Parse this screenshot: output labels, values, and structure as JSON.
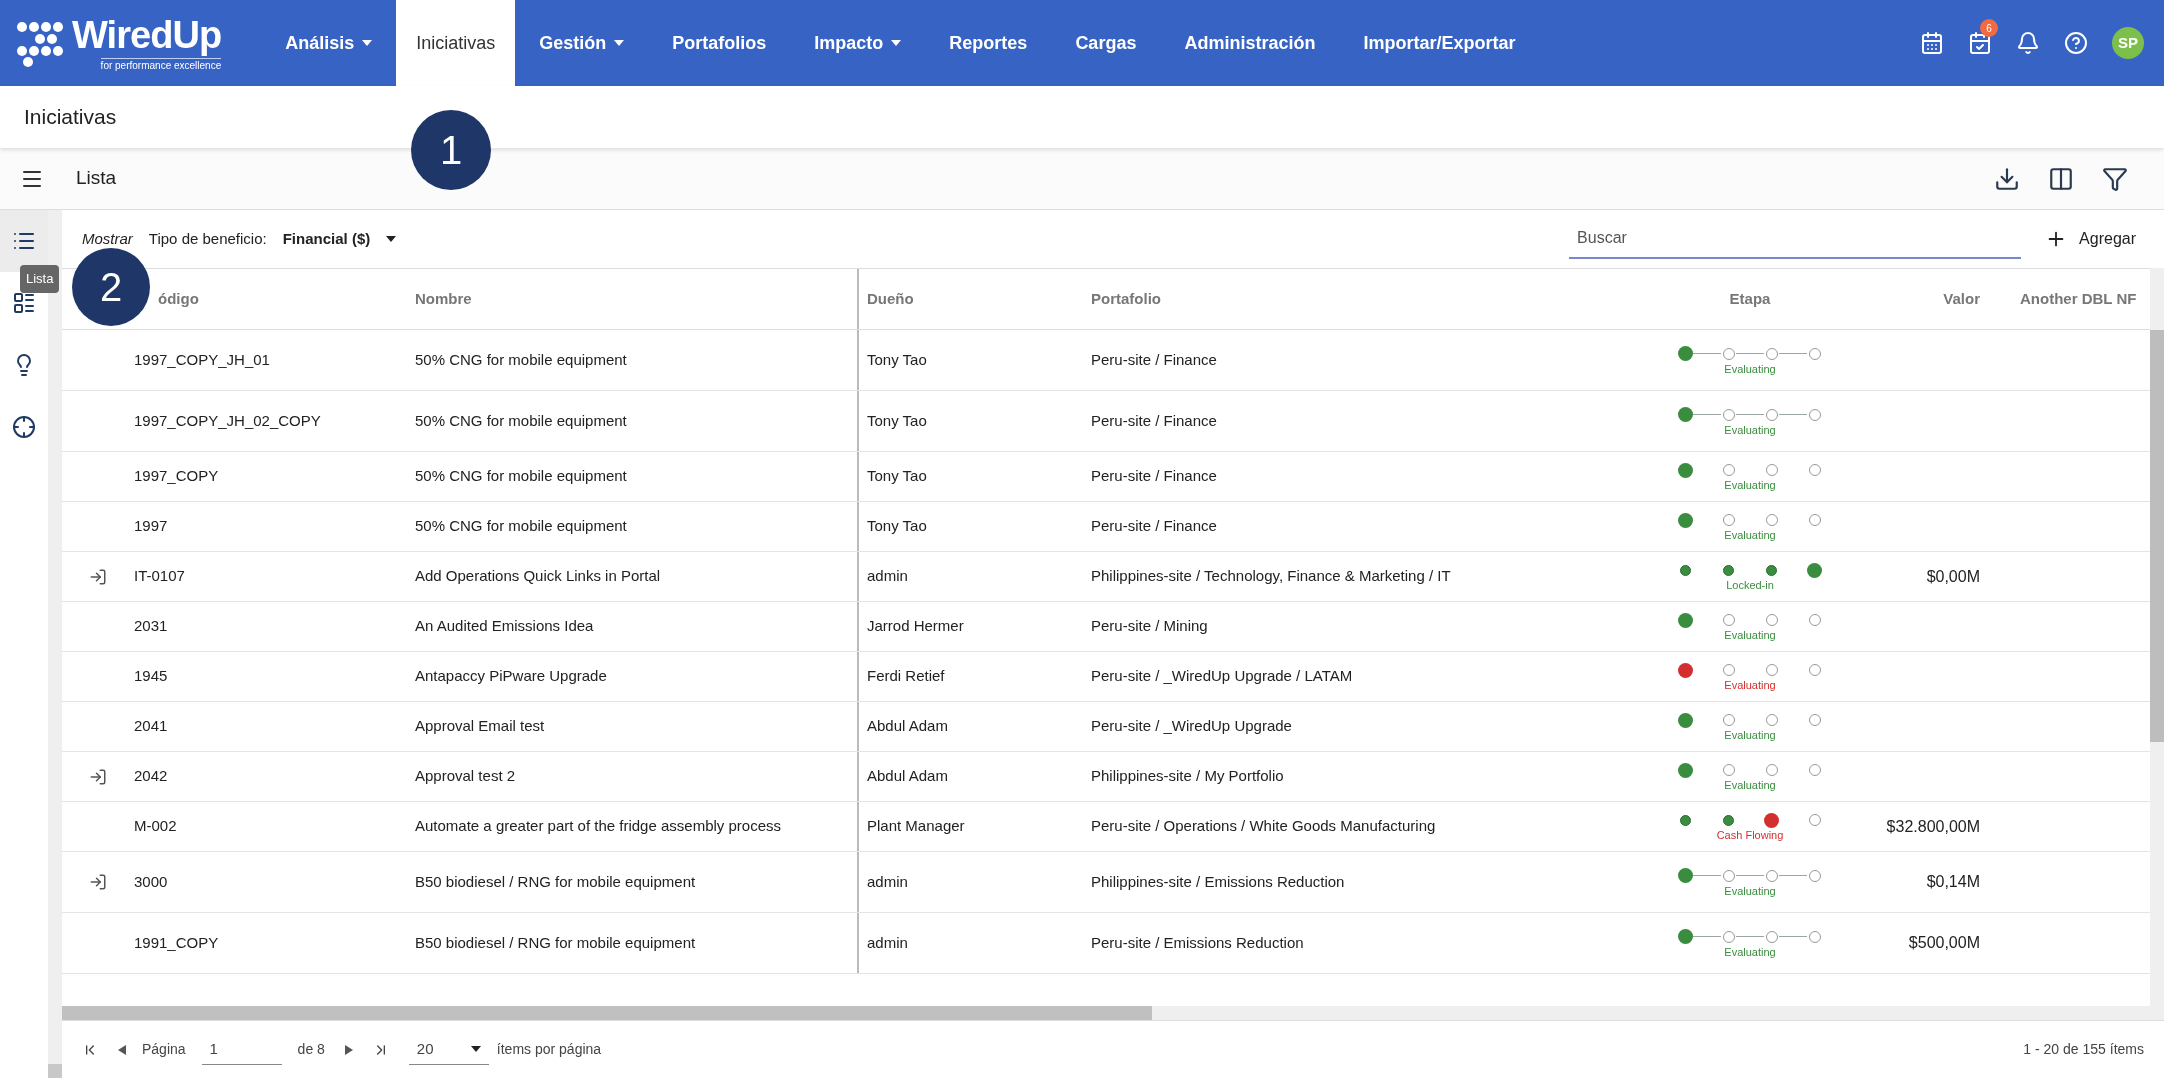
{
  "logo": {
    "name": "WiredUp",
    "tagline": "for performance excellence"
  },
  "nav": [
    {
      "label": "Análisis",
      "dropdown": true,
      "selected": false
    },
    {
      "label": "Iniciativas",
      "dropdown": false,
      "selected": true
    },
    {
      "label": "Gestión",
      "dropdown": true,
      "selected": false
    },
    {
      "label": "Portafolios",
      "dropdown": false,
      "selected": false
    },
    {
      "label": "Impacto",
      "dropdown": true,
      "selected": false
    },
    {
      "label": "Reportes",
      "dropdown": false,
      "selected": false
    },
    {
      "label": "Cargas",
      "dropdown": false,
      "selected": false
    },
    {
      "label": "Administración",
      "dropdown": false,
      "selected": false
    },
    {
      "label": "Importar/Exportar",
      "dropdown": false,
      "selected": false
    }
  ],
  "tasks_badge": "6",
  "avatar": "SP",
  "page_title": "Iniciativas",
  "view_title": "Lista",
  "rail": [
    {
      "kind": "list",
      "selected": true
    },
    {
      "kind": "details",
      "selected": false
    },
    {
      "kind": "idea",
      "selected": false
    },
    {
      "kind": "target",
      "selected": false
    }
  ],
  "tooltip": "Lista",
  "filter": {
    "show_label": "Mostrar",
    "benefit_label": "Tipo de beneficio:",
    "benefit_value": "Financial ($)"
  },
  "search": {
    "placeholder": "Buscar"
  },
  "add_button": "Agregar",
  "table": {
    "columns": [
      "",
      "ódigo",
      "Nombre",
      "Dueño",
      "Portafolio",
      "Etapa",
      "Valor",
      "Another DBL NF"
    ],
    "rows": [
      {
        "linked": false,
        "code": "1997_COPY_JH_01",
        "name": "50% CNG for mobile equipment",
        "owner": "Tony Tao",
        "portfolio": "Peru-site / Finance",
        "stage": {
          "steps": [
            {
              "filled": true,
              "current": true
            },
            {
              "filled": false,
              "current": false
            },
            {
              "filled": false,
              "current": false
            },
            {
              "filled": false,
              "current": false
            }
          ],
          "connected": true,
          "label": "Evaluating",
          "color": "#3a8c3f"
        },
        "value": ""
      },
      {
        "linked": false,
        "code": "1997_COPY_JH_02_COPY",
        "name": "50% CNG for mobile equipment",
        "owner": "Tony Tao",
        "portfolio": "Peru-site / Finance",
        "stage": {
          "steps": [
            {
              "filled": true,
              "current": true
            },
            {
              "filled": false,
              "current": false
            },
            {
              "filled": false,
              "current": false
            },
            {
              "filled": false,
              "current": false
            }
          ],
          "connected": true,
          "label": "Evaluating",
          "color": "#3a8c3f"
        },
        "value": ""
      },
      {
        "linked": false,
        "code": "1997_COPY",
        "name": "50% CNG for mobile equipment",
        "owner": "Tony Tao",
        "portfolio": "Peru-site / Finance",
        "stage": {
          "steps": [
            {
              "filled": true,
              "current": true
            },
            {
              "filled": false,
              "current": false
            },
            {
              "filled": false,
              "current": false
            },
            {
              "filled": false,
              "current": false
            }
          ],
          "connected": false,
          "label": "Evaluating",
          "color": "#3a8c3f"
        },
        "value": ""
      },
      {
        "linked": false,
        "code": "1997",
        "name": "50% CNG for mobile equipment",
        "owner": "Tony Tao",
        "portfolio": "Peru-site / Finance",
        "stage": {
          "steps": [
            {
              "filled": true,
              "current": true
            },
            {
              "filled": false,
              "current": false
            },
            {
              "filled": false,
              "current": false
            },
            {
              "filled": false,
              "current": false
            }
          ],
          "connected": false,
          "label": "Evaluating",
          "color": "#3a8c3f"
        },
        "value": ""
      },
      {
        "linked": true,
        "code": "IT-0107",
        "name": "Add Operations Quick Links in Portal",
        "owner": "admin",
        "portfolio": "Philippines-site / Technology, Finance & Marketing / IT",
        "stage": {
          "steps": [
            {
              "filled": true,
              "current": false
            },
            {
              "filled": true,
              "current": false
            },
            {
              "filled": true,
              "current": false
            },
            {
              "filled": true,
              "current": true
            }
          ],
          "connected": false,
          "label": "Locked-in",
          "color": "#3a8c3f"
        },
        "value": "$0,00M"
      },
      {
        "linked": false,
        "code": "2031",
        "name": "An Audited Emissions Idea",
        "owner": "Jarrod Hermer",
        "portfolio": "Peru-site / Mining",
        "stage": {
          "steps": [
            {
              "filled": true,
              "current": true
            },
            {
              "filled": false,
              "current": false
            },
            {
              "filled": false,
              "current": false
            },
            {
              "filled": false,
              "current": false
            }
          ],
          "connected": false,
          "label": "Evaluating",
          "color": "#3a8c3f"
        },
        "value": ""
      },
      {
        "linked": false,
        "code": "1945",
        "name": "Antapaccy PiPware Upgrade",
        "owner": "Ferdi Retief",
        "portfolio": "Peru-site / _WiredUp Upgrade / LATAM",
        "stage": {
          "steps": [
            {
              "filled": true,
              "current": true
            },
            {
              "filled": false,
              "current": false
            },
            {
              "filled": false,
              "current": false
            },
            {
              "filled": false,
              "current": false
            }
          ],
          "connected": false,
          "label": "Evaluating",
          "color": "#d32f2f"
        },
        "value": ""
      },
      {
        "linked": false,
        "code": "2041",
        "name": "Approval Email test",
        "owner": "Abdul Adam",
        "portfolio": "Peru-site / _WiredUp Upgrade",
        "stage": {
          "steps": [
            {
              "filled": true,
              "current": true
            },
            {
              "filled": false,
              "current": false
            },
            {
              "filled": false,
              "current": false
            },
            {
              "filled": false,
              "current": false
            }
          ],
          "connected": false,
          "label": "Evaluating",
          "color": "#3a8c3f"
        },
        "value": ""
      },
      {
        "linked": true,
        "code": "2042",
        "name": "Approval test 2",
        "owner": "Abdul Adam",
        "portfolio": "Philippines-site / My Portfolio",
        "stage": {
          "steps": [
            {
              "filled": true,
              "current": true
            },
            {
              "filled": false,
              "current": false
            },
            {
              "filled": false,
              "current": false
            },
            {
              "filled": false,
              "current": false
            }
          ],
          "connected": false,
          "label": "Evaluating",
          "color": "#3a8c3f"
        },
        "value": ""
      },
      {
        "linked": false,
        "code": "M-002",
        "name": "Automate a greater part of the fridge assembly process",
        "owner": "Plant Manager",
        "portfolio": "Peru-site / Operations / White Goods Manufacturing",
        "stage": {
          "steps": [
            {
              "filled": true,
              "current": false
            },
            {
              "filled": true,
              "current": false
            },
            {
              "filled": true,
              "current": true
            },
            {
              "filled": false,
              "current": false
            }
          ],
          "connected": false,
          "label": "Cash Flowing",
          "color": "#d32f2f"
        },
        "value": "$32.800,00M"
      },
      {
        "linked": true,
        "code": "3000",
        "name": "B50 biodiesel / RNG for mobile equipment",
        "owner": "admin",
        "portfolio": "Philippines-site / Emissions Reduction",
        "stage": {
          "steps": [
            {
              "filled": true,
              "current": true
            },
            {
              "filled": false,
              "current": false
            },
            {
              "filled": false,
              "current": false
            },
            {
              "filled": false,
              "current": false
            }
          ],
          "connected": true,
          "label": "Evaluating",
          "color": "#3a8c3f"
        },
        "value": "$0,14M"
      },
      {
        "linked": false,
        "code": "1991_COPY",
        "name": "B50 biodiesel / RNG for mobile equipment",
        "owner": "admin",
        "portfolio": "Peru-site / Emissions Reduction",
        "stage": {
          "steps": [
            {
              "filled": true,
              "current": true
            },
            {
              "filled": false,
              "current": false
            },
            {
              "filled": false,
              "current": false
            },
            {
              "filled": false,
              "current": false
            }
          ],
          "connected": true,
          "label": "Evaluating",
          "color": "#3a8c3f"
        },
        "value": "$500,00M"
      }
    ]
  },
  "pager": {
    "page_label": "Página",
    "page": "1",
    "of": "de 8",
    "page_size": "20",
    "per_page": "ítems por página",
    "summary": "1 - 20 de 155 ítems"
  },
  "annotations": [
    "1",
    "2"
  ]
}
